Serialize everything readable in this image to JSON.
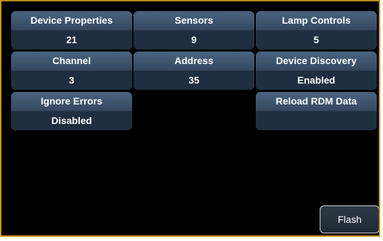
{
  "tiles": [
    {
      "label": "Device Properties",
      "value": "21"
    },
    {
      "label": "Sensors",
      "value": "9"
    },
    {
      "label": "Lamp Controls",
      "value": "5"
    },
    {
      "label": "Channel",
      "value": "3"
    },
    {
      "label": "Address",
      "value": "35"
    },
    {
      "label": "Device Discovery",
      "value": "Enabled"
    },
    {
      "label": "Ignore Errors",
      "value": "Disabled"
    },
    {
      "label": "Reload RDM Data",
      "value": ""
    }
  ],
  "flash_label": "Flash",
  "colors": {
    "frame_border": "#c79a22",
    "tile_header": "#4a6380",
    "tile_value": "#1f2f40",
    "background": "#000000",
    "text": "#ffffff"
  }
}
